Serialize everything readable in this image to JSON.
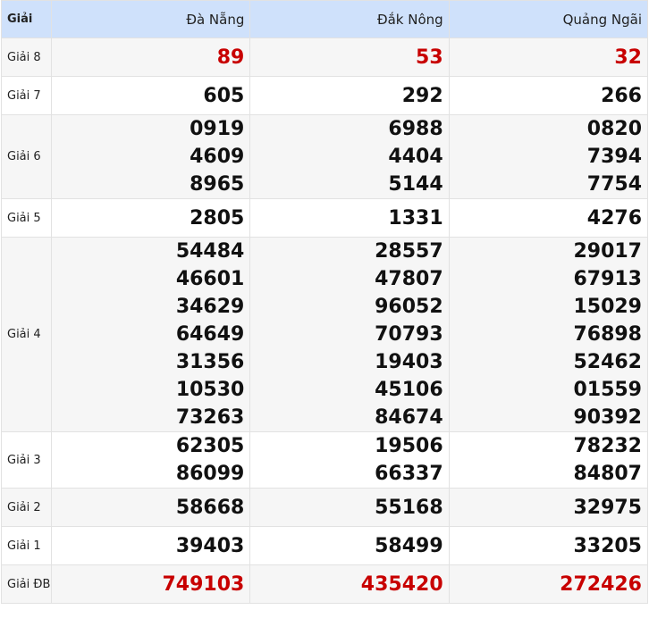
{
  "header": {
    "label": "Giải",
    "provinces": [
      "Đà Nẵng",
      "Đắk Nông",
      "Quảng Ngãi"
    ]
  },
  "prizes": [
    {
      "label": "Giải 8",
      "red": true,
      "values": [
        [
          "89"
        ],
        [
          "53"
        ],
        [
          "32"
        ]
      ]
    },
    {
      "label": "Giải 7",
      "red": false,
      "values": [
        [
          "605"
        ],
        [
          "292"
        ],
        [
          "266"
        ]
      ]
    },
    {
      "label": "Giải 6",
      "red": false,
      "values": [
        [
          "0919",
          "4609",
          "8965"
        ],
        [
          "6988",
          "4404",
          "5144"
        ],
        [
          "0820",
          "7394",
          "7754"
        ]
      ]
    },
    {
      "label": "Giải 5",
      "red": false,
      "values": [
        [
          "2805"
        ],
        [
          "1331"
        ],
        [
          "4276"
        ]
      ]
    },
    {
      "label": "Giải 4",
      "red": false,
      "values": [
        [
          "54484",
          "46601",
          "34629",
          "64649",
          "31356",
          "10530",
          "73263"
        ],
        [
          "28557",
          "47807",
          "96052",
          "70793",
          "19403",
          "45106",
          "84674"
        ],
        [
          "29017",
          "67913",
          "15029",
          "76898",
          "52462",
          "01559",
          "90392"
        ]
      ]
    },
    {
      "label": "Giải 3",
      "red": false,
      "values": [
        [
          "62305",
          "86099"
        ],
        [
          "19506",
          "66337"
        ],
        [
          "78232",
          "84807"
        ]
      ]
    },
    {
      "label": "Giải 2",
      "red": false,
      "values": [
        [
          "58668"
        ],
        [
          "55168"
        ],
        [
          "32975"
        ]
      ]
    },
    {
      "label": "Giải 1",
      "red": false,
      "values": [
        [
          "39403"
        ],
        [
          "58499"
        ],
        [
          "33205"
        ]
      ]
    },
    {
      "label": "Giải ĐB",
      "red": true,
      "values": [
        [
          "749103"
        ],
        [
          "435420"
        ],
        [
          "272426"
        ]
      ]
    }
  ]
}
